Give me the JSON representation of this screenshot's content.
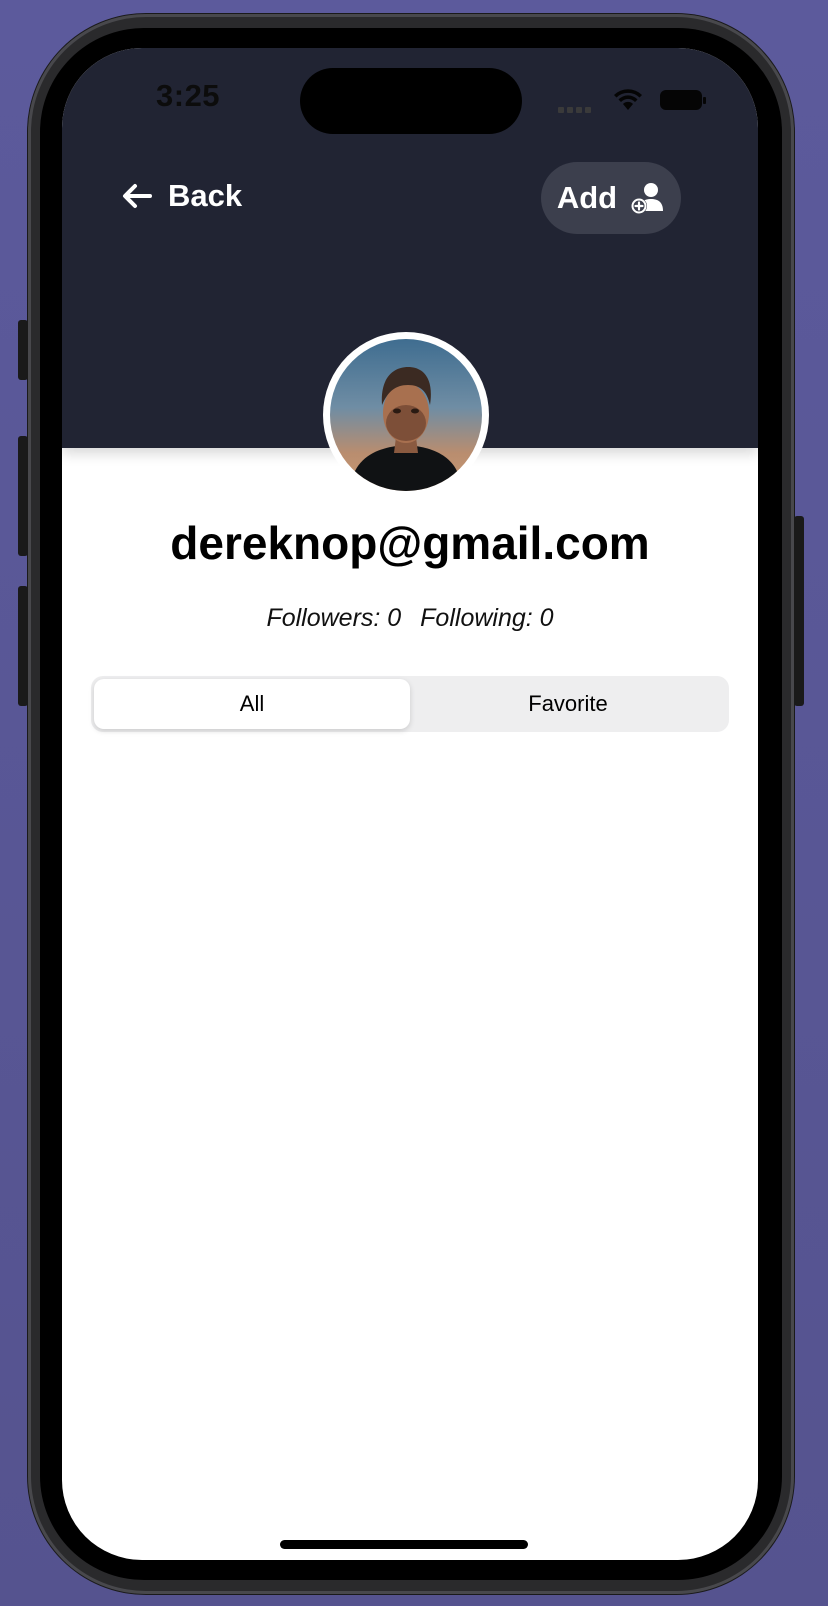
{
  "status_bar": {
    "time": "3:25"
  },
  "header": {
    "back_label": "Back",
    "add_label": "Add"
  },
  "profile": {
    "email": "dereknop@gmail.com",
    "followers": "Followers: 0",
    "following": "Following: 0"
  },
  "segments": [
    {
      "label": "All",
      "selected": true
    },
    {
      "label": "Favorite",
      "selected": false
    }
  ],
  "colors": {
    "header_bg": "#212433",
    "add_button_bg": "#3c3f4d",
    "backdrop": "#5c5a9c"
  }
}
